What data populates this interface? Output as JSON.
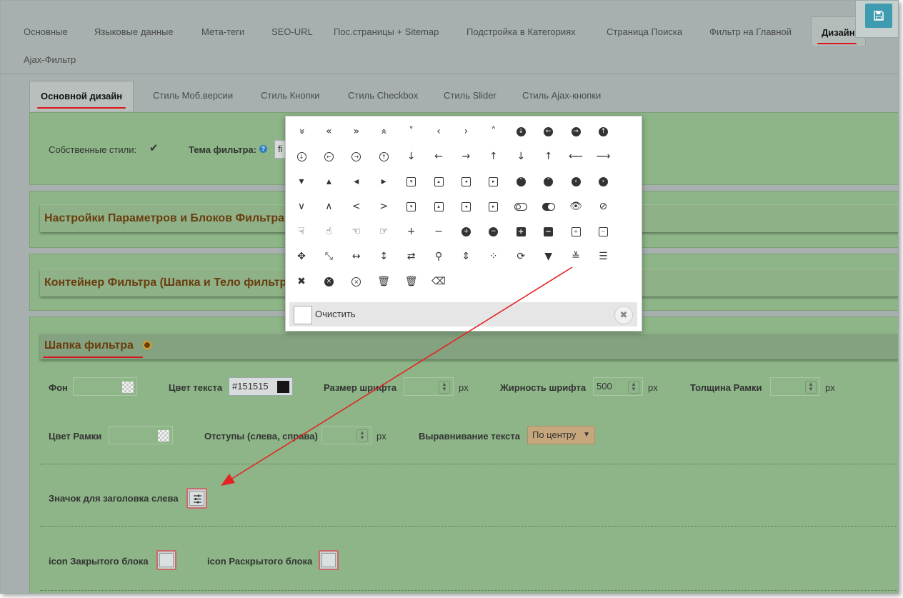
{
  "top_tabs": [
    "Основные",
    "Языковые данные",
    "Мета-теги",
    "SEO-URL",
    "Пос.страницы + Sitemap",
    "Подстройка в Категориях",
    "Страница Поиска",
    "Фильтр на Главной",
    "Дизайн",
    "Ajax-Фильтр"
  ],
  "active_top_tab": "Дизайн",
  "sub_tabs": [
    "Основной дизайн",
    "Стиль Моб.версии",
    "Стиль Кнопки",
    "Стиль Checkbox",
    "Стиль Slider",
    "Стиль Ajax-кнопки"
  ],
  "active_sub_tab": "Основной дизайн",
  "top_panel": {
    "own_styles_label": "Собственные стили:",
    "own_styles_checked": true,
    "theme_label": "Тема фильтра:",
    "theme_value_partial": "fi"
  },
  "sections": {
    "params": "Настройки Параметров и Блоков Фильтра",
    "container": "Контейнер Фильтра (Шапка и Тело фильтр",
    "header": "Шапка фильтра"
  },
  "header_fields": {
    "bg_label": "Фон",
    "text_color_label": "Цвет текста",
    "text_color_value": "#151515",
    "font_size_label": "Размер шрифта",
    "font_weight_label": "Жирность шрифта",
    "font_weight_value": "500",
    "border_width_label": "Толщина Рамки",
    "border_color_label": "Цвет Рамки",
    "padding_label": "Отступы (слева, справа)",
    "align_label": "Выравнивание текста",
    "align_value": "По центру",
    "unit": "px",
    "left_icon_label": "Значок для заголовка слева",
    "closed_icon_label": "icon Закрытого блока",
    "open_icon_label": "icon Раскрытого блока"
  },
  "icon_picker": {
    "clear_label": "Очистить",
    "close_symbol": "✖",
    "rows": [
      [
        "»v",
        "«",
        "»",
        "^^",
        "v",
        "‹",
        "›",
        "^",
        "c↓",
        "c←",
        "c→",
        "c↑"
      ],
      [
        "o↓",
        "o←",
        "o→",
        "o↑",
        "↓",
        "←",
        "→",
        "↑",
        "|↓",
        "|↑",
        "⟵",
        "⟶"
      ],
      [
        "▾",
        "▴",
        "◂",
        "▸",
        "sqv",
        "sq^",
        "sq<",
        "sq>",
        "cv",
        "c^",
        "c<",
        "c>"
      ],
      [
        "∨",
        "∧",
        "<",
        ">",
        "sqv",
        "sq^",
        "sq<",
        "sq>",
        "tog",
        "togon",
        "eye",
        "eye-slash"
      ],
      [
        "hand-d",
        "hand-u",
        "hand-l",
        "hand-r",
        "+",
        "−",
        "c+",
        "c−",
        "s+",
        "s−",
        "o+",
        "o−"
      ],
      [
        "move",
        "expand",
        "↔",
        "↕",
        "⇄",
        "search",
        "sort",
        "spinner",
        "refresh",
        "filter",
        "sliders",
        "bars"
      ],
      [
        "✖",
        "cx",
        "ox",
        "trash",
        "trash-o",
        "eraser"
      ]
    ]
  },
  "colors": {
    "text_color_swatch": "#151515",
    "accent_red": "#d9151b",
    "panel_green": "#8db587",
    "save_button": "#3f9bb0"
  }
}
